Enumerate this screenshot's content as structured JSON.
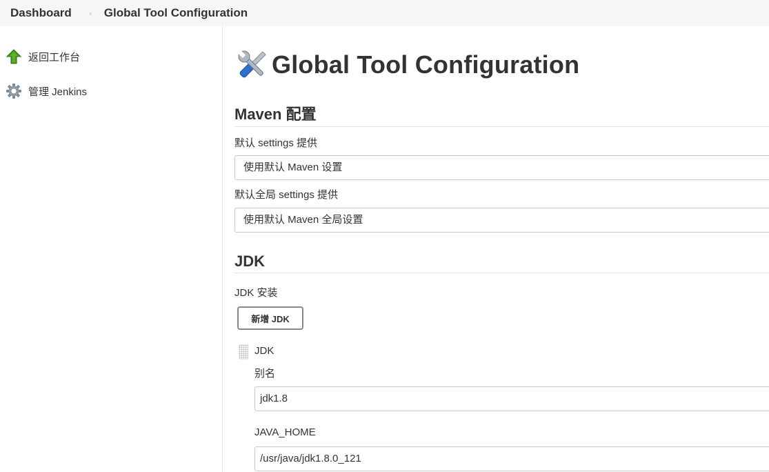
{
  "breadcrumb": {
    "items": [
      "Dashboard",
      "Global Tool Configuration"
    ],
    "separator": "›"
  },
  "sidebar": {
    "items": [
      {
        "label": "返回工作台",
        "icon": "up-arrow-icon"
      },
      {
        "label": "管理 Jenkins",
        "icon": "gear-icon"
      }
    ]
  },
  "page": {
    "title": "Global Tool Configuration",
    "title_icon": "tools-icon"
  },
  "maven": {
    "section_title": "Maven 配置",
    "settings_label": "默认 settings 提供",
    "settings_value": "使用默认 Maven 设置",
    "global_settings_label": "默认全局 settings 提供",
    "global_settings_value": "使用默认 Maven 全局设置"
  },
  "jdk": {
    "section_title": "JDK",
    "install_label": "JDK 安装",
    "add_button": "新增 JDK",
    "item_title": "JDK",
    "alias_label": "别名",
    "alias_value": "jdk1.8",
    "java_home_label": "JAVA_HOME",
    "java_home_value": "/usr/java/jdk1.8.0_121"
  },
  "colors": {
    "breadcrumb_bg": "#f6f6f6",
    "arrow_green": "#4a9a1e",
    "gear_gray": "#7b8896"
  }
}
